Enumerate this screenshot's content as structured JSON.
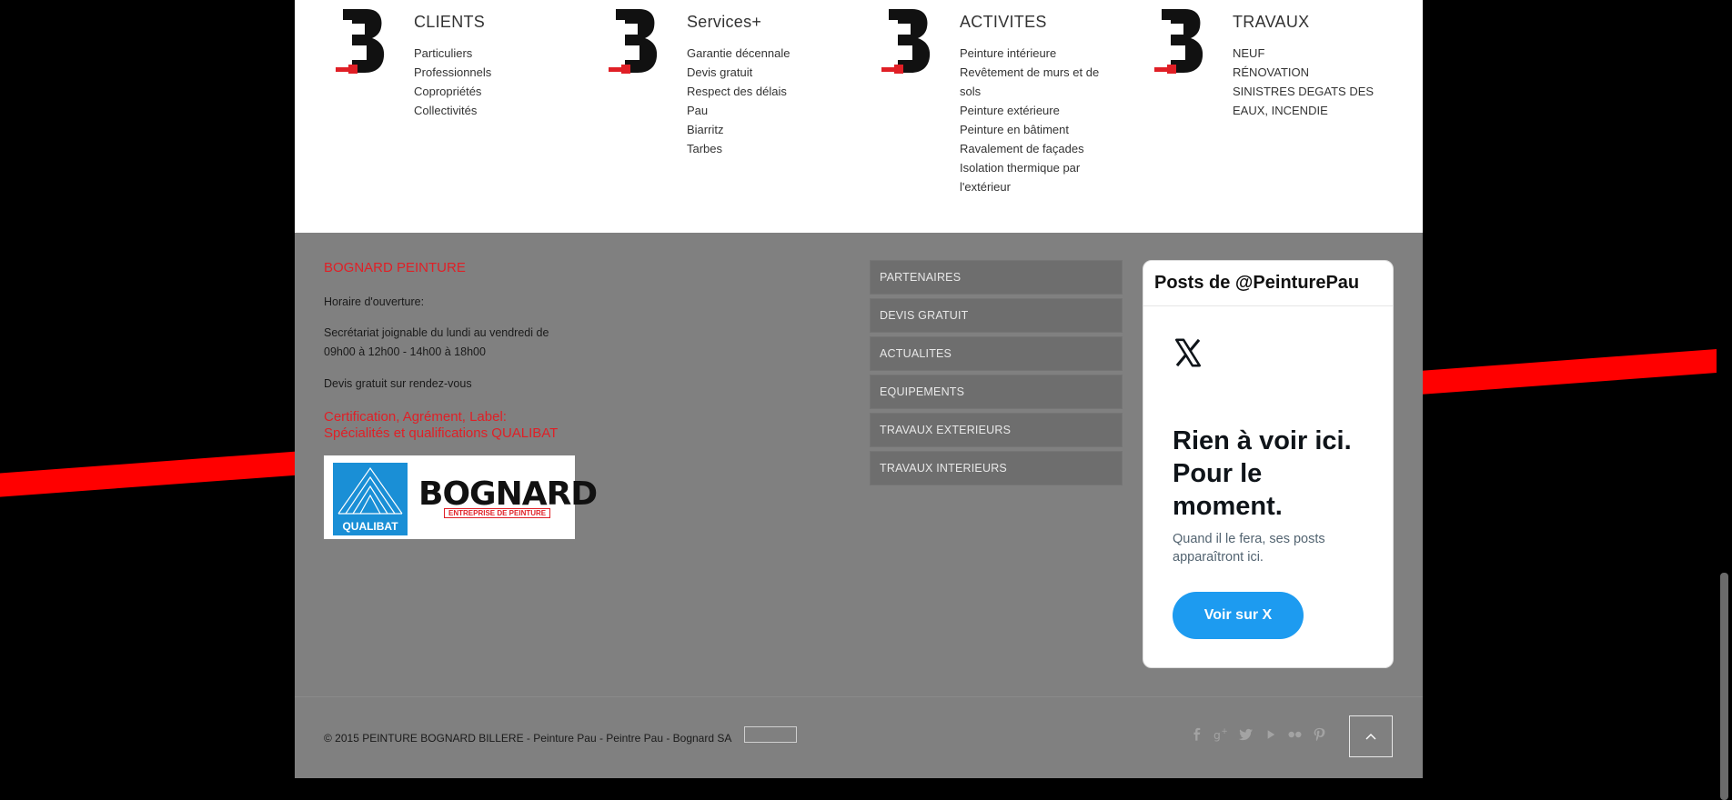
{
  "columns": [
    {
      "title": "CLIENTS",
      "items": [
        "Particuliers",
        "Professionnels",
        "Copropriétés",
        "Collectivités"
      ]
    },
    {
      "title": "Services+",
      "items": [
        "Garantie décennale",
        "Devis gratuit",
        "Respect des délais",
        "Pau",
        "Biarritz",
        "Tarbes"
      ]
    },
    {
      "title": "ACTIVITES",
      "items": [
        "Peinture intérieure",
        "Revêtement de murs et de sols",
        "Peinture extérieure",
        "Peinture en bâtiment",
        "Ravalement de façades",
        "Isolation thermique par l'extérieur"
      ]
    },
    {
      "title": "TRAVAUX",
      "items": [
        "NEUF",
        "RÉNOVATION",
        "SINISTRES DEGATS DES EAUX, INCENDIE"
      ]
    }
  ],
  "footer": {
    "company": "BOGNARD PEINTURE",
    "hours_label": "Horaire d'ouverture:",
    "secretariat": "Secrétariat joignable du lundi au vendredi de 09h00 à 12h00 - 14h00 à 18h00",
    "quote": "Devis gratuit sur rendez-vous",
    "cert_line1": "Certification, Agrément, Label:",
    "cert_line2": "Spécialités et qualifications QUALIBAT",
    "qualibat_label": "QUALIBAT",
    "bognard_logo_text": "BOGNARD",
    "bognard_logo_sub": "ENTREPRISE DE PEINTURE"
  },
  "menu": [
    "PARTENAIRES",
    "DEVIS GRATUIT",
    "ACTUALITES",
    "EQUIPEMENTS",
    "TRAVAUX EXTERIEURS",
    "TRAVAUX INTERIEURS"
  ],
  "twitter": {
    "header": "Posts de @PeinturePau",
    "headline": "Rien à voir ici. Pour le moment.",
    "subtext": "Quand il le fera, ses posts apparaîtront ici.",
    "button": "Voir sur X"
  },
  "bottom": {
    "copyright": "© 2015 PEINTURE BOGNARD BILLERE - Peinture Pau - Peintre Pau - Bognard SA",
    "socials": [
      "facebook-icon",
      "google-plus-icon",
      "twitter-icon",
      "youtube-icon",
      "flickr-icon",
      "pinterest-icon"
    ]
  },
  "colors": {
    "accent_red": "#e01f26",
    "footer_grey": "#808080",
    "twitter_blue": "#1d9bf0"
  }
}
